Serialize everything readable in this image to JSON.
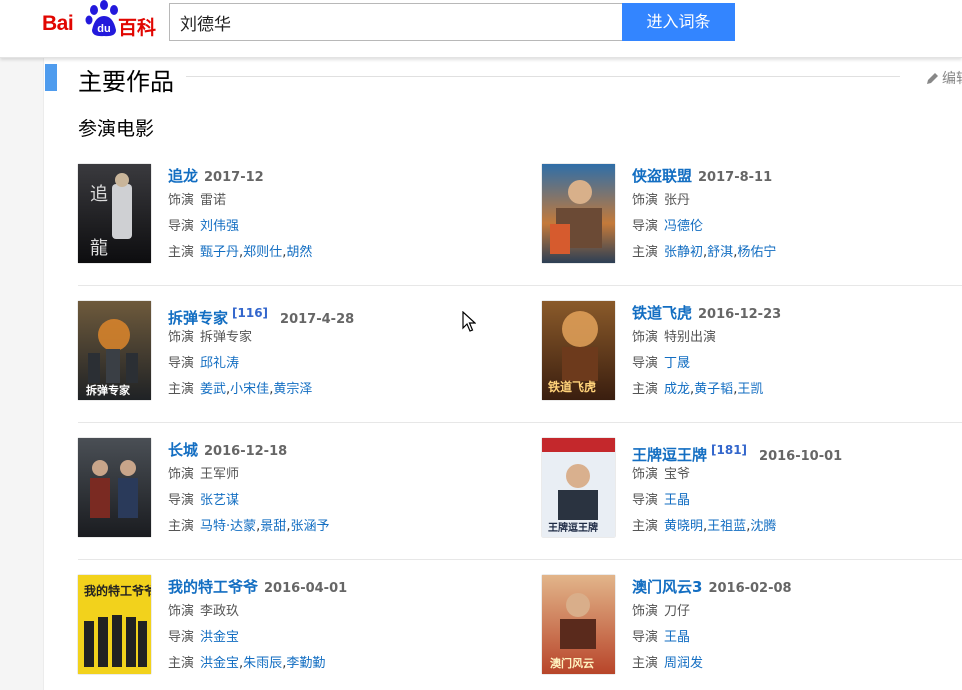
{
  "logo": {
    "text_bai": "Bai",
    "text_du": "du",
    "text_baike": "百科"
  },
  "search": {
    "value": "刘德华",
    "button_label": "进入词条"
  },
  "section": {
    "title": "主要作品",
    "edit_label": "编辑",
    "subsection": "参演电影"
  },
  "labels": {
    "role": "饰演",
    "director": "导演",
    "cast": "主演"
  },
  "colors": {
    "link": "#136ec2",
    "accent": "#4f9cee",
    "search_button": "#3385ff",
    "logo_red": "#e10601"
  },
  "movies": [
    {
      "title": "追龙",
      "ref": "",
      "date": "2017-12",
      "role": "雷诺",
      "director": "刘伟强",
      "cast": [
        "甄子丹",
        "郑则仕",
        "胡然"
      ]
    },
    {
      "title": "侠盗联盟",
      "ref": "",
      "date": "2017-8-11",
      "role": "张丹",
      "director": "冯德伦",
      "cast": [
        "张静初",
        "舒淇",
        "杨佑宁"
      ]
    },
    {
      "title": "拆弹专家",
      "ref": "[116]",
      "date": "2017-4-28",
      "role": "拆弹专家",
      "director": "邱礼涛",
      "cast": [
        "姜武",
        "小宋佳",
        "黄宗泽"
      ]
    },
    {
      "title": "铁道飞虎",
      "ref": "",
      "date": "2016-12-23",
      "role": "特别出演",
      "director": "丁晟",
      "cast": [
        "成龙",
        "黄子韬",
        "王凯"
      ]
    },
    {
      "title": "长城",
      "ref": "",
      "date": "2016-12-18",
      "role": "王军师",
      "director": "张艺谋",
      "cast": [
        "马特·达蒙",
        "景甜",
        "张涵予"
      ]
    },
    {
      "title": "王牌逗王牌",
      "ref": "[181]",
      "date": "2016-10-01",
      "role": "宝爷",
      "director": "王晶",
      "cast": [
        "黄晓明",
        "王祖蓝",
        "沈腾"
      ]
    },
    {
      "title": "我的特工爷爷",
      "ref": "",
      "date": "2016-04-01",
      "role": "李政玖",
      "director": "洪金宝",
      "cast": [
        "洪金宝",
        "朱雨辰",
        "李勤勤"
      ]
    },
    {
      "title": "澳门风云3",
      "ref": "",
      "date": "2016-02-08",
      "role": "刀仔",
      "director": "王晶",
      "cast": [
        "周润发"
      ]
    }
  ]
}
